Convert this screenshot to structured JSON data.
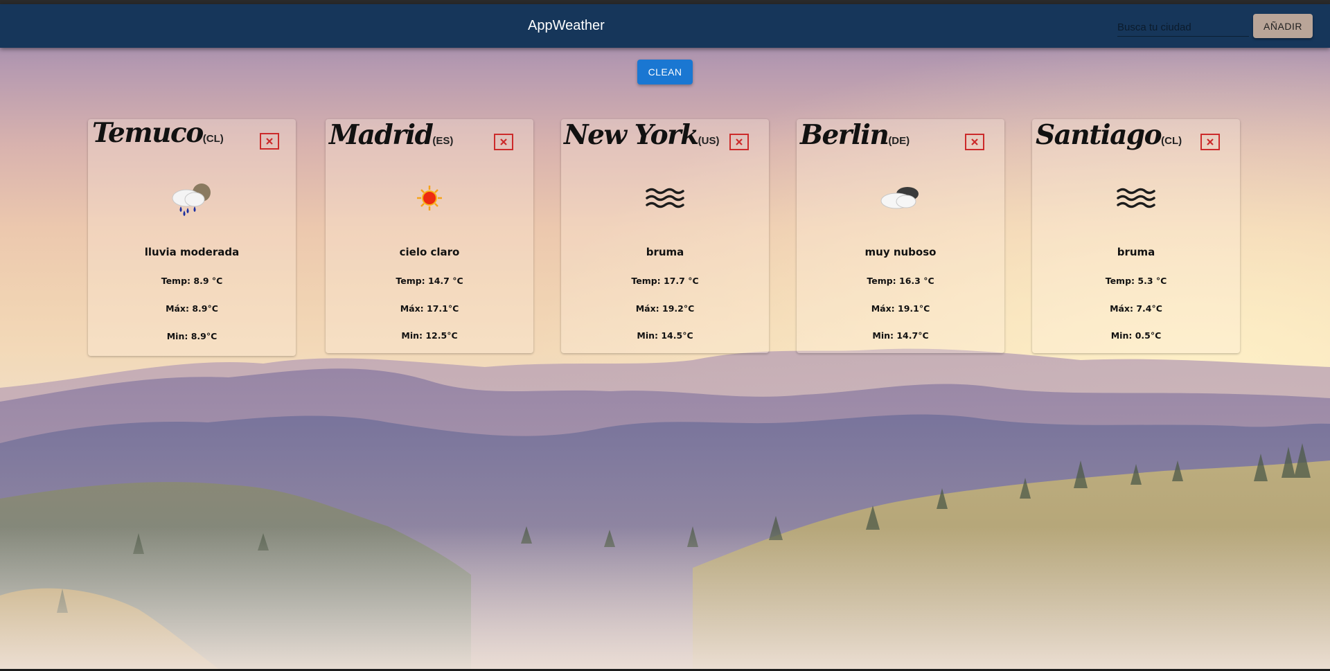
{
  "header": {
    "title": "AppWeather",
    "search_placeholder": "Busca tu ciudad",
    "add_label": "AÑADIR"
  },
  "toolbar": {
    "clean_label": "CLEAN"
  },
  "cards": [
    {
      "city": "Temuco",
      "country": "(CL)",
      "icon": "rain-cloud-icon",
      "description": "lluvia moderada",
      "temp": "Temp: 8.9 °C",
      "max": "Máx: 8.9°C",
      "min": "Min: 8.9°C"
    },
    {
      "city": "Madrid",
      "country": "(ES)",
      "icon": "sun-icon",
      "description": "cielo claro",
      "temp": "Temp: 14.7 °C",
      "max": "Máx: 17.1°C",
      "min": "Min: 12.5°C"
    },
    {
      "city": "New York",
      "country": "(US)",
      "icon": "mist-icon",
      "description": "bruma",
      "temp": "Temp: 17.7 °C",
      "max": "Máx: 19.2°C",
      "min": "Min: 14.5°C"
    },
    {
      "city": "Berlin",
      "country": "(DE)",
      "icon": "broken-clouds-icon",
      "description": "muy nuboso",
      "temp": "Temp: 16.3 °C",
      "max": "Máx: 19.1°C",
      "min": "Min: 14.7°C"
    },
    {
      "city": "Santiago",
      "country": "(CL)",
      "icon": "mist-icon",
      "description": "bruma",
      "temp": "Temp: 5.3 °C",
      "max": "Máx: 7.4°C",
      "min": "Min: 0.5°C"
    }
  ],
  "colors": {
    "appbar": "#16365a",
    "clean_button": "#1a77d2",
    "add_button": "#b9a598",
    "close_icon": "#cc2a2a"
  }
}
